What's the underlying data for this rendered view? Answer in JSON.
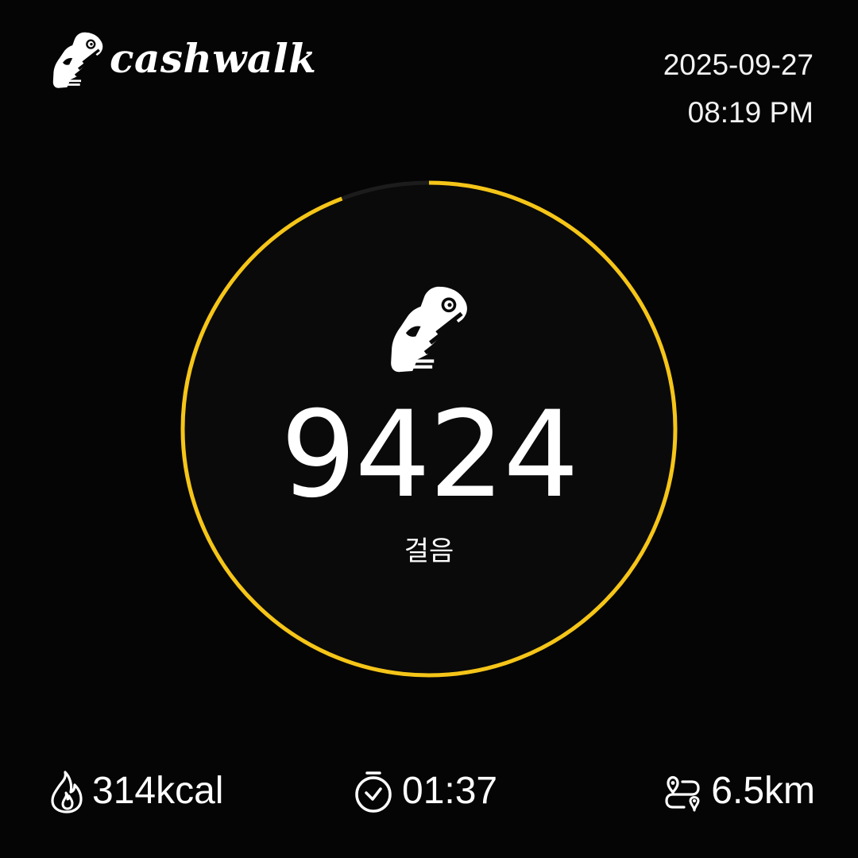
{
  "header": {
    "brand_name": "cashwalk",
    "date": "2025-09-27",
    "time": "08:19 PM"
  },
  "steps": {
    "value": "9424",
    "unit": "걸음",
    "progress": 0.9424
  },
  "stats": {
    "calories": "314kcal",
    "duration": "01:37",
    "distance": "6.5km"
  },
  "icons": {
    "logo": "sneaker-icon",
    "center": "sneaker-icon",
    "calories": "flame-icon",
    "duration": "stopwatch-icon",
    "distance": "route-icon"
  },
  "colors": {
    "background": "#050505",
    "ring_progress": "#f5c518",
    "ring_track": "#1c1c1c",
    "text": "#ffffff"
  }
}
